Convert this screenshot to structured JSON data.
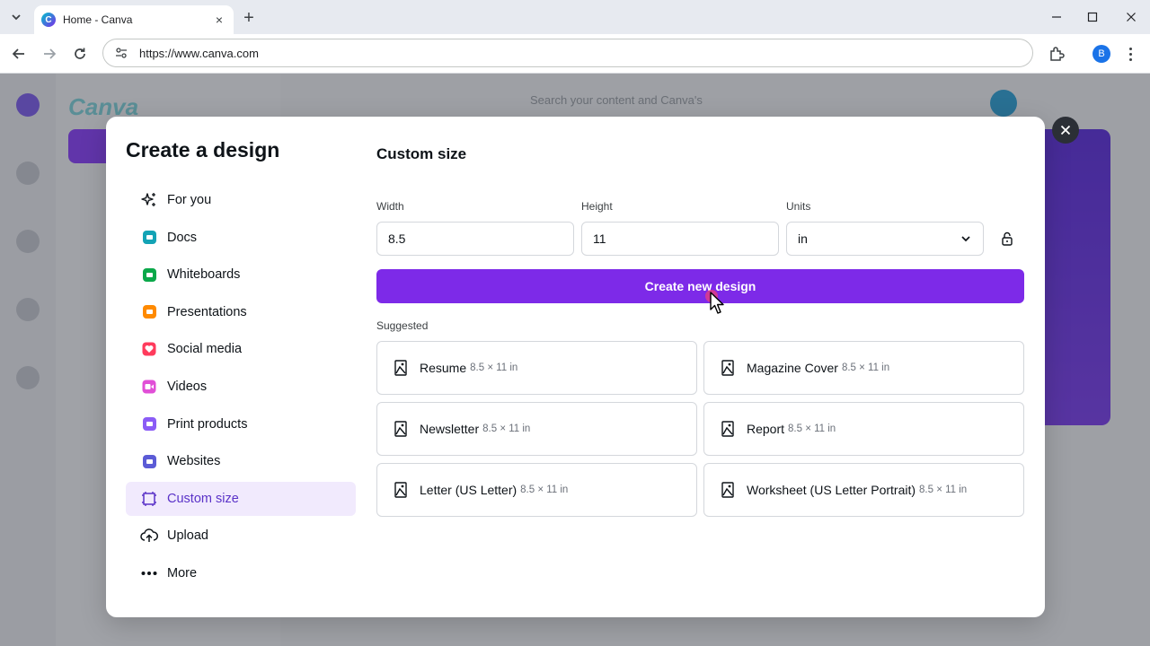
{
  "browser": {
    "tab": {
      "title": "Home - Canva",
      "favicon": "C",
      "close_icon": "×"
    },
    "new_tab_icon": "+",
    "url": "https://www.canva.com",
    "profile_initial": "B"
  },
  "background": {
    "logo": "Canva",
    "search_placeholder": "Search your content and Canva's"
  },
  "modal": {
    "title": "Create a design",
    "menu": [
      {
        "label": "For you",
        "icon": "sparkle-icon"
      },
      {
        "label": "Docs",
        "icon": "docs-icon",
        "color": "#13a3b5"
      },
      {
        "label": "Whiteboards",
        "icon": "whiteboard-icon",
        "color": "#0ba84a"
      },
      {
        "label": "Presentations",
        "icon": "presentation-icon",
        "color": "#ff8a00"
      },
      {
        "label": "Social media",
        "icon": "heart-icon",
        "color": "#ff3b5c"
      },
      {
        "label": "Videos",
        "icon": "video-icon",
        "color": "#e14fd7"
      },
      {
        "label": "Print products",
        "icon": "print-icon",
        "color": "#8b5cf6"
      },
      {
        "label": "Websites",
        "icon": "website-icon",
        "color": "#5b5bd6"
      },
      {
        "label": "Custom size",
        "icon": "custom-size-icon",
        "active": true
      },
      {
        "label": "Upload",
        "icon": "upload-cloud-icon"
      },
      {
        "label": "More",
        "icon": "more-dots-icon"
      }
    ],
    "custom": {
      "title": "Custom size",
      "width_label": "Width",
      "width_value": "8.5",
      "height_label": "Height",
      "height_value": "11",
      "units_label": "Units",
      "units_value": "in",
      "create_button": "Create new design",
      "suggested_label": "Suggested",
      "suggestions": [
        {
          "name": "Resume",
          "size": "8.5 × 11 in"
        },
        {
          "name": "Magazine Cover",
          "size": "8.5 × 11 in"
        },
        {
          "name": "Newsletter",
          "size": "8.5 × 11 in"
        },
        {
          "name": "Report",
          "size": "8.5 × 11 in"
        },
        {
          "name": "Letter (US Letter)",
          "size": "8.5 × 11 in"
        },
        {
          "name": "Worksheet (US Letter Portrait)",
          "size": "8.5 × 11 in"
        }
      ]
    },
    "close_icon": "close-icon"
  },
  "colors": {
    "accent": "#7d2ae8",
    "active_bg": "#f1eafd",
    "active_text": "#5a32c8"
  }
}
